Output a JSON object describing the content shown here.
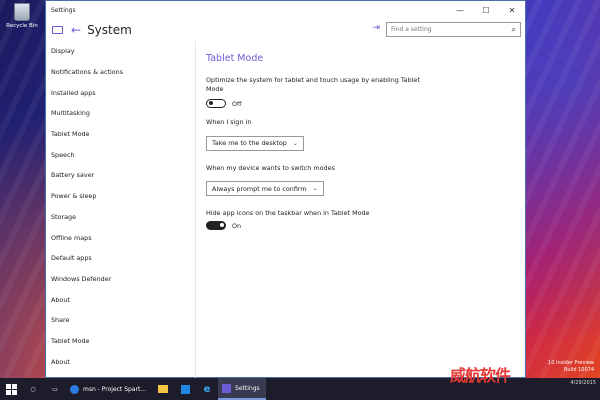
{
  "desktop": {
    "recycle_bin_label": "Recycle Bin",
    "preview_line1": "10 Insider Preview",
    "preview_line2": "Build 10074"
  },
  "window": {
    "title": "Settings",
    "minimize": "—",
    "maximize": "☐",
    "close": "✕"
  },
  "header": {
    "back_icon": "←",
    "title": "System",
    "pin_icon": "⇥",
    "search_placeholder": "Find a setting",
    "search_icon": "⌕"
  },
  "sidebar": {
    "items": [
      {
        "label": "Display"
      },
      {
        "label": "Notifications & actions"
      },
      {
        "label": "Installed apps"
      },
      {
        "label": "Multitasking"
      },
      {
        "label": "Tablet Mode"
      },
      {
        "label": "Speech"
      },
      {
        "label": "Battery saver"
      },
      {
        "label": "Power & sleep"
      },
      {
        "label": "Storage"
      },
      {
        "label": "Offline maps"
      },
      {
        "label": "Default apps"
      },
      {
        "label": "Windows Defender"
      },
      {
        "label": "About"
      },
      {
        "label": "Share"
      },
      {
        "label": "Tablet Mode"
      },
      {
        "label": "About"
      }
    ]
  },
  "content": {
    "heading": "Tablet Mode",
    "optimize_desc": "Optimize the system for tablet and touch usage by enabling Tablet Mode",
    "tablet_toggle_state": "Off",
    "signin_label": "When I sign in",
    "signin_value": "Take me to the desktop",
    "switch_label": "When my device wants to switch modes",
    "switch_value": "Always prompt me to confirm",
    "hide_icons_label": "Hide app icons on the taskbar when in Tablet Mode",
    "hide_icons_state": "On"
  },
  "taskbar": {
    "app1": "msn - Project Spart...",
    "app2": "Settings",
    "date": "4/29/2015"
  },
  "colors": {
    "accent": "#6b5cd6",
    "taskbar": "#1c1c2a"
  }
}
